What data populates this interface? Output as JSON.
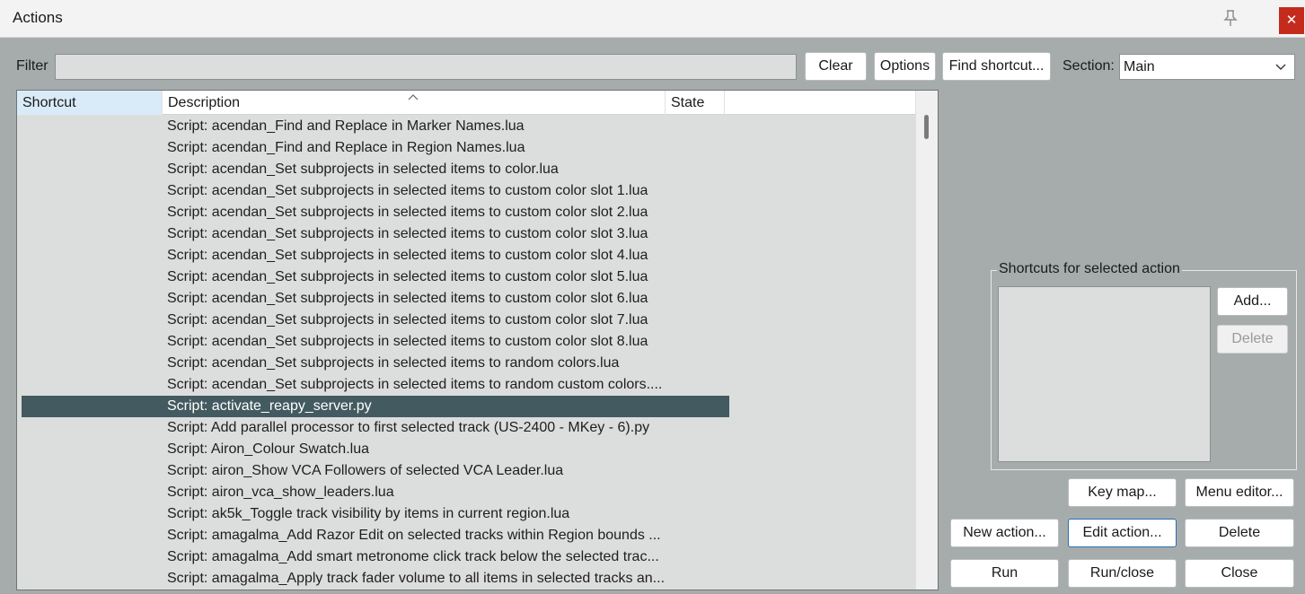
{
  "window": {
    "title": "Actions"
  },
  "filter": {
    "label": "Filter",
    "value": ""
  },
  "toolbar": {
    "clear": "Clear",
    "options": "Options",
    "find_shortcut": "Find shortcut..."
  },
  "section": {
    "label": "Section:",
    "value": "Main"
  },
  "columns": {
    "shortcut": "Shortcut",
    "description": "Description",
    "state": "State"
  },
  "rows": [
    "Script: acendan_Find and Replace in Marker Names.lua",
    "Script: acendan_Find and Replace in Region Names.lua",
    "Script: acendan_Set subprojects in selected items to color.lua",
    "Script: acendan_Set subprojects in selected items to custom color slot 1.lua",
    "Script: acendan_Set subprojects in selected items to custom color slot 2.lua",
    "Script: acendan_Set subprojects in selected items to custom color slot 3.lua",
    "Script: acendan_Set subprojects in selected items to custom color slot 4.lua",
    "Script: acendan_Set subprojects in selected items to custom color slot 5.lua",
    "Script: acendan_Set subprojects in selected items to custom color slot 6.lua",
    "Script: acendan_Set subprojects in selected items to custom color slot 7.lua",
    "Script: acendan_Set subprojects in selected items to custom color slot 8.lua",
    "Script: acendan_Set subprojects in selected items to random colors.lua",
    "Script: acendan_Set subprojects in selected items to random custom colors....",
    "Script: activate_reapy_server.py",
    "Script: Add parallel processor to first selected track (US-2400 - MKey - 6).py",
    "Script: Airon_Colour Swatch.lua",
    "Script: airon_Show VCA Followers of selected VCA Leader.lua",
    "Script: airon_vca_show_leaders.lua",
    "Script: ak5k_Toggle track visibility by items in current region.lua",
    "Script: amagalma_Add Razor Edit on selected tracks within Region bounds ...",
    "Script: amagalma_Add smart metronome click track below the selected trac...",
    "Script: amagalma_Apply track fader volume to all items in selected tracks an..."
  ],
  "selected_row": 13,
  "shortcuts_panel": {
    "label": "Shortcuts for selected action",
    "add": "Add...",
    "delete": "Delete"
  },
  "buttons": {
    "key_map": "Key map...",
    "menu_editor": "Menu editor...",
    "new_action": "New action...",
    "edit_action": "Edit action...",
    "delete": "Delete",
    "run": "Run",
    "run_close": "Run/close",
    "close": "Close"
  },
  "colors": {
    "selected_row": "#435a60",
    "close_button": "#c42b1c",
    "background": "#a6acac"
  }
}
